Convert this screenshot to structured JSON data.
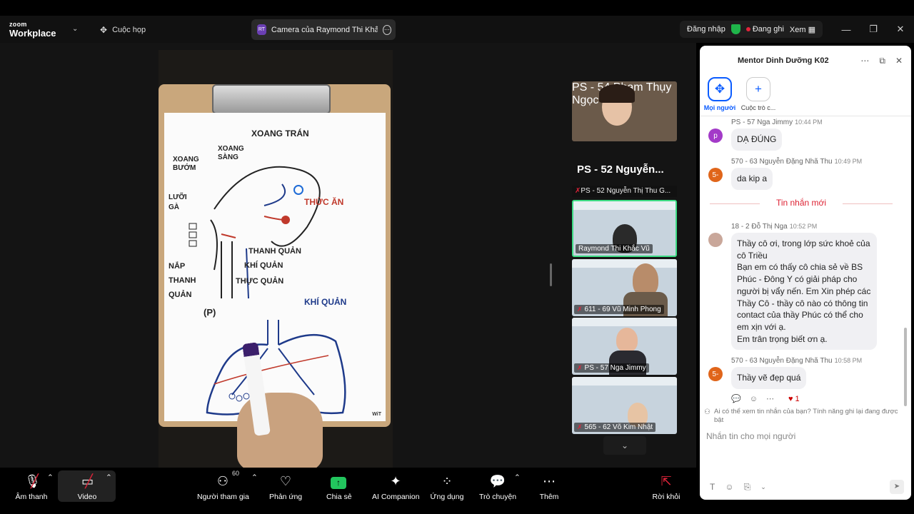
{
  "app": {
    "logo_small": "zoom",
    "logo_big": "Workplace",
    "meetings_label": "Cuộc họp",
    "camera_tab": "Camera của Raymond Thi Khắc Vũ",
    "camera_tab_initials": "RT",
    "signin": "Đăng nhập",
    "recording": "Đang ghi",
    "view": "Xem"
  },
  "stage": {
    "speaker_name": "PS - 52 Nguyễn...",
    "active_tile_header": "PS - 52 Nguyễn Thị Thu G...",
    "whiteboard": {
      "watermark": "WiT",
      "labels": [
        "XOANG TRÁN",
        "XOANG BƯỚM",
        "XOANG SÀNG",
        "LƯỠI GÀ",
        "THỨC ĂN",
        "THANH QUẢN",
        "KHÍ QUẢN",
        "THỰC QUẢN",
        "NẮP THANH QUẢN",
        "(P)",
        "KHÍ QUẢN"
      ]
    },
    "participants": [
      {
        "name": "PS - 54 Phạm Thụy Ngọc Hu..."
      },
      {
        "name": "Raymond Thi Khắc Vũ"
      },
      {
        "name": "611 - 69 Vũ Minh Phong"
      },
      {
        "name": "PS - 57 Nga Jimmy"
      },
      {
        "name": "565 - 62 Võ Kim Nhật"
      }
    ]
  },
  "chat": {
    "title": "Mentor Dinh Dưỡng K02",
    "tab_everyone": "Mọi người",
    "tab_new": "Cuộc trò c...",
    "new_messages": "Tin nhắn mới",
    "messages": [
      {
        "avatar": "p",
        "sender": "PS - 57 Nga Jimmy",
        "time": "10:44 PM",
        "text": "DẠ ĐÚNG",
        "color": "#a33ac8"
      },
      {
        "avatar": "5-",
        "sender": "570 - 63 Nguyễn Đặng Nhã Thu",
        "time": "10:49 PM",
        "text": "da kip a",
        "color": "#e0651a"
      },
      {
        "avatar": "",
        "sender": "18 - 2 Đỗ Thị Nga",
        "time": "10:52 PM",
        "text": "Thầy cô ơi, trong lớp sức khoẻ của cô Triều\nBạn em có thấy cô chia sẻ về BS Phúc - Đông Y có giải pháp cho người bị vẩy nến. Em Xin phép các Thầy Cô - thầy cô nào có thông tin contact của thầy Phúc có thể cho em xịn với ạ.\nEm trân trọng biết ơn ạ.",
        "color": "#c9a79a"
      },
      {
        "avatar": "5-",
        "sender": "570 - 63 Nguyễn Đặng Nhã Thu",
        "time": "10:58 PM",
        "text": "Thầy vẽ đẹp quá",
        "color": "#e0651a"
      }
    ],
    "reaction_count": "1",
    "notice": "Ai có thể xem tin nhắn của bạn? Tính năng ghi lại đang được bật",
    "compose_placeholder": "Nhắn tin cho mọi người"
  },
  "toolbar": {
    "audio": "Âm thanh",
    "video": "Video",
    "participants": "Người tham gia",
    "participant_count": "60",
    "reactions": "Phản ứng",
    "share": "Chia sẻ",
    "ai": "AI Companion",
    "apps": "Ứng dụng",
    "chat": "Trò chuyện",
    "more": "Thêm",
    "leave": "Rời khỏi"
  },
  "colors": {
    "accent": "#0b5cff",
    "record": "#e0243a",
    "share": "#22c55e",
    "active_border": "#3ddc84"
  }
}
